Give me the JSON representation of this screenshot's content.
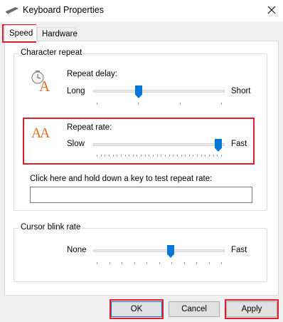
{
  "window": {
    "title": "Keyboard Properties"
  },
  "tabs": [
    {
      "label": "Speed",
      "active": true
    },
    {
      "label": "Hardware",
      "active": false
    }
  ],
  "character_repeat": {
    "title": "Character repeat",
    "repeat_delay": {
      "label": "Repeat delay:",
      "min_label": "Long",
      "max_label": "Short",
      "level": 0.33
    },
    "repeat_rate": {
      "label": "Repeat rate:",
      "min_label": "Slow",
      "max_label": "Fast",
      "level": 1.0
    },
    "test": {
      "label": "Click here and hold down a key to test repeat rate:",
      "value": ""
    }
  },
  "cursor_blink": {
    "title": "Cursor blink rate",
    "min_label": "None",
    "max_label": "Fast",
    "level": 0.6
  },
  "buttons": {
    "ok": "OK",
    "cancel": "Cancel",
    "apply": "Apply"
  },
  "colors": {
    "accent": "#0078d7",
    "highlight": "#e21b2d"
  },
  "icons": {
    "repeat_delay": "clock-letter-a-icon",
    "repeat_rate": "double-letter-a-icon"
  }
}
